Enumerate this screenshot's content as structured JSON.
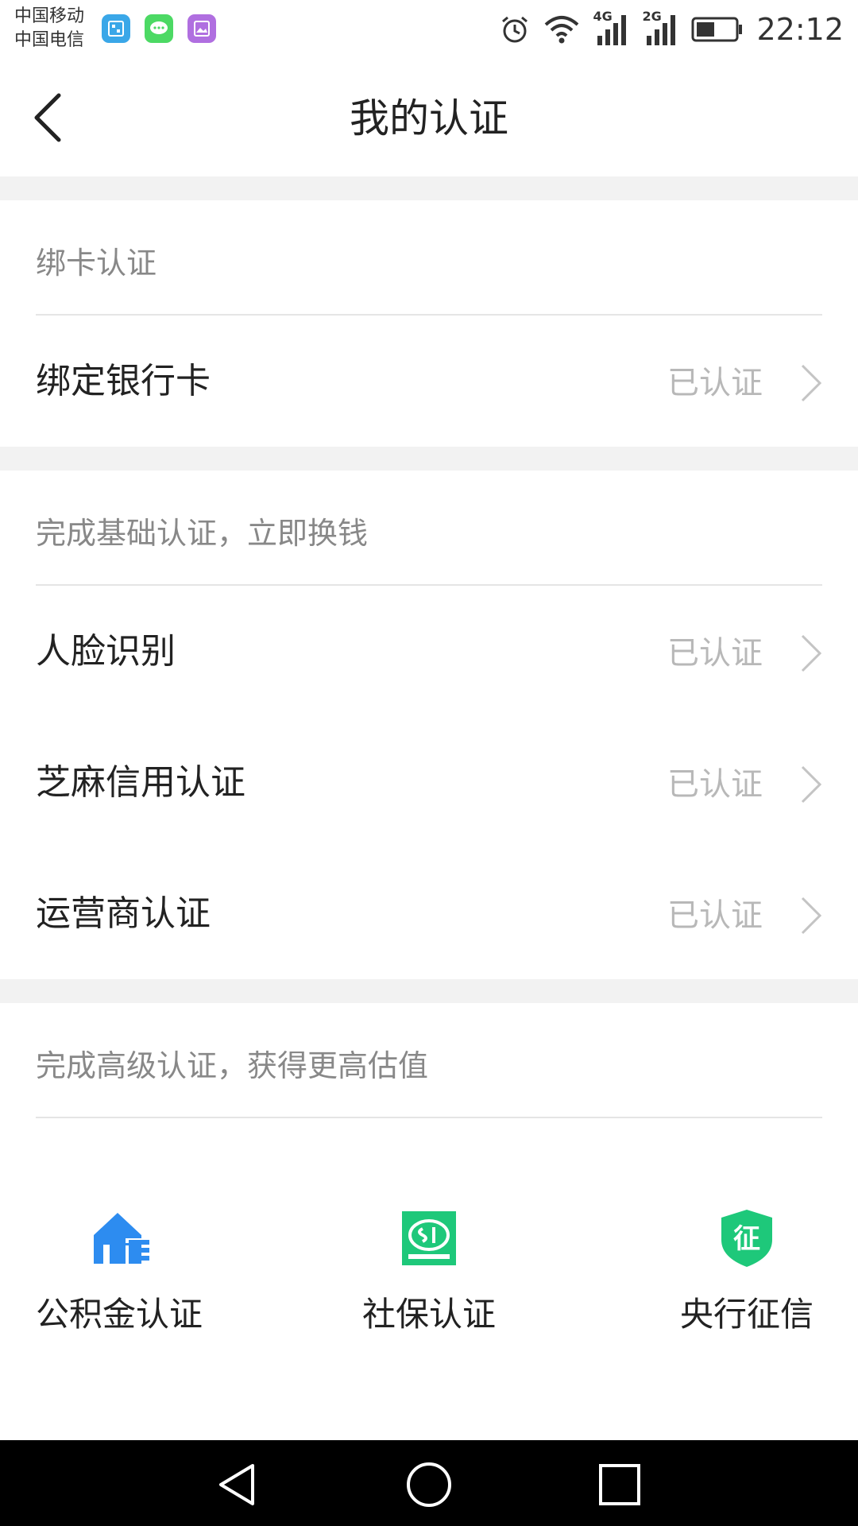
{
  "status_bar": {
    "carrier_1": "中国移动",
    "carrier_2": "中国电信",
    "network_1": "4G",
    "network_2": "2G",
    "time": "22:12",
    "notification_icons": [
      "emui-icon",
      "message-icon",
      "gallery-icon"
    ]
  },
  "header": {
    "title": "我的认证"
  },
  "sections": {
    "card": {
      "header": "绑卡认证",
      "items": [
        {
          "label": "绑定银行卡",
          "status": "已认证"
        }
      ]
    },
    "basic": {
      "header": "完成基础认证，立即换钱",
      "items": [
        {
          "label": "人脸识别",
          "status": "已认证"
        },
        {
          "label": "芝麻信用认证",
          "status": "已认证"
        },
        {
          "label": "运营商认证",
          "status": "已认证"
        }
      ]
    },
    "advanced": {
      "header": "完成高级认证，获得更高估值",
      "tiles": [
        {
          "label": "公积金认证",
          "icon": "housing-fund-icon"
        },
        {
          "label": "社保认证",
          "icon": "social-security-icon"
        },
        {
          "label": "央行征信",
          "icon": "credit-shield-icon",
          "icon_text": "征"
        }
      ]
    }
  },
  "colors": {
    "accent_blue": "#2d8cf0",
    "accent_green": "#1ec87a",
    "status_gray": "#b8b8b8",
    "band_gray": "#f2f2f2"
  }
}
